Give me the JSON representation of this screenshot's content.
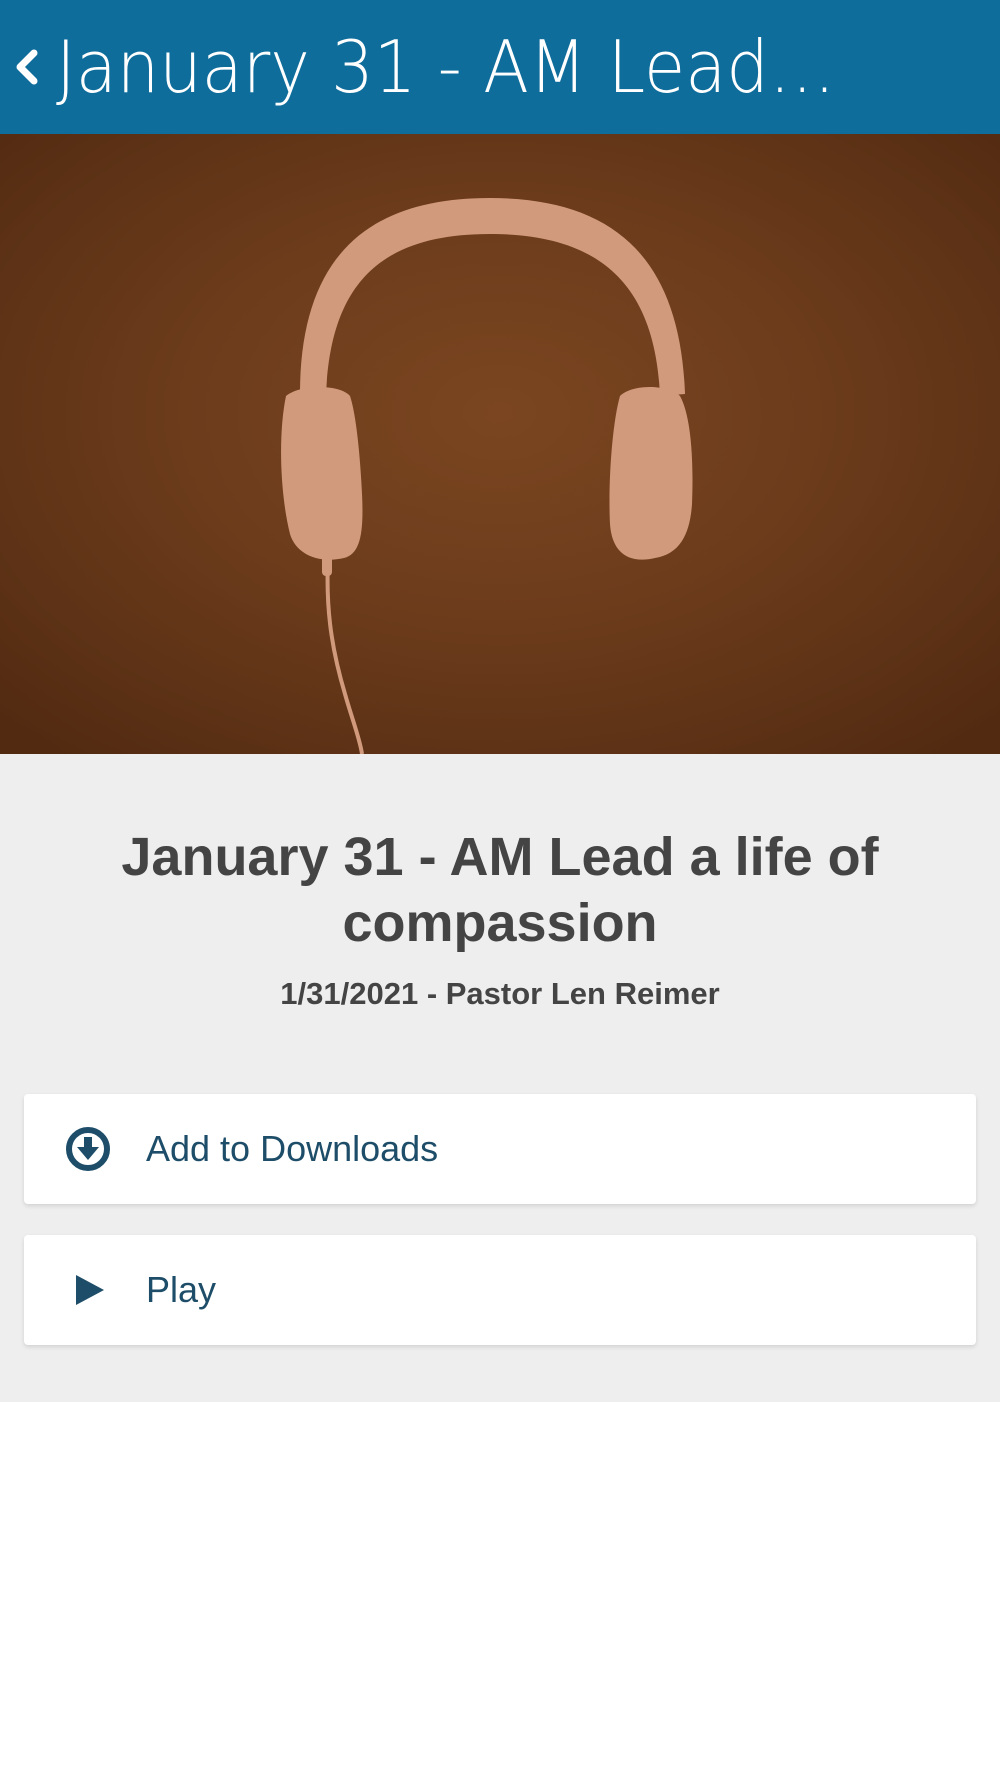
{
  "header": {
    "back_icon": "chevron-left-icon",
    "title": "January 31 - AM Lead a life of compassion"
  },
  "hero": {
    "image": "headphones-illustration",
    "background_color": "#6e3d1c",
    "graphic_color": "#d19a7c"
  },
  "sermon": {
    "title": "January 31 - AM Lead a life of compassion",
    "meta": "1/31/2021 - Pastor Len Reimer"
  },
  "actions": [
    {
      "icon": "download-circle-icon",
      "label": "Add to Downloads"
    },
    {
      "icon": "play-icon",
      "label": "Play"
    }
  ],
  "colors": {
    "app_bar": "#0f6d9c",
    "action_text": "#1d4d68",
    "content_bg": "#eeeeee"
  }
}
